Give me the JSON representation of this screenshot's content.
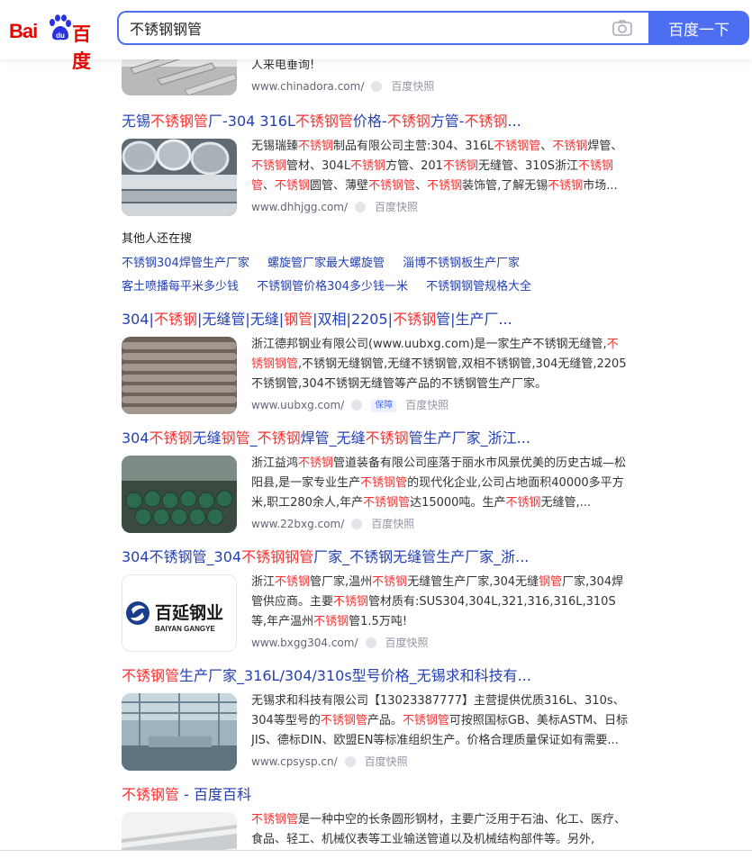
{
  "header": {
    "logo_latin": "Bai",
    "logo_cn": "百度",
    "search_value": "不锈钢钢管",
    "search_button": "百度一下"
  },
  "results": [
    {
      "title": [],
      "abstract": [
        {
          "t": "人来电垂询!"
        }
      ],
      "url": "www.chinadora.com/",
      "kuaizhao": "百度快照"
    },
    {
      "title": [
        {
          "t": "无锡"
        },
        {
          "t": "不锈钢管",
          "h": 1
        },
        {
          "t": "厂-304 316L"
        },
        {
          "t": "不锈钢管",
          "h": 1
        },
        {
          "t": "价格-"
        },
        {
          "t": "不锈钢",
          "h": 1
        },
        {
          "t": "方管-"
        },
        {
          "t": "不锈钢",
          "h": 1
        },
        {
          "t": "..."
        }
      ],
      "abstract": [
        {
          "t": "无锡瑞臻"
        },
        {
          "t": "不锈钢",
          "h": 1
        },
        {
          "t": "制品有限公司主营:304、316L"
        },
        {
          "t": "不锈钢管",
          "h": 1
        },
        {
          "t": "、"
        },
        {
          "t": "不锈钢",
          "h": 1
        },
        {
          "t": "焊管、"
        },
        {
          "t": "不锈钢",
          "h": 1
        },
        {
          "t": "管材、304L"
        },
        {
          "t": "不锈钢",
          "h": 1
        },
        {
          "t": "方管、201"
        },
        {
          "t": "不锈钢",
          "h": 1
        },
        {
          "t": "无缝管、310S浙江"
        },
        {
          "t": "不锈钢管",
          "h": 1
        },
        {
          "t": "、"
        },
        {
          "t": "不锈钢",
          "h": 1
        },
        {
          "t": "圆管、薄壁"
        },
        {
          "t": "不锈钢管",
          "h": 1
        },
        {
          "t": "、"
        },
        {
          "t": "不锈钢",
          "h": 1
        },
        {
          "t": "装饰管,了解无锡"
        },
        {
          "t": "不锈钢",
          "h": 1
        },
        {
          "t": "市场..."
        }
      ],
      "url": "www.dhhjgg.com/",
      "kuaizhao": "百度快照"
    },
    {
      "title": [
        {
          "t": "304|"
        },
        {
          "t": "不锈钢",
          "h": 1
        },
        {
          "t": "|无缝管|无缝|"
        },
        {
          "t": "钢管",
          "h": 1
        },
        {
          "t": "|双相|2205|"
        },
        {
          "t": "不锈钢",
          "h": 1
        },
        {
          "t": "管|生产厂..."
        }
      ],
      "abstract": [
        {
          "t": "浙江德邦钢业有限公司(www.uubxg.com)是一家生产不锈钢无缝管,"
        },
        {
          "t": "不锈钢钢管",
          "h": 1
        },
        {
          "t": ",不锈钢无缝钢管,无缝不锈钢管,双相不锈钢管,304无缝管,2205不锈钢管,304不锈钢无缝管等产品的不锈钢管生产厂家。"
        }
      ],
      "url": "www.uubxg.com/",
      "badge": "保障",
      "kuaizhao": "百度快照"
    },
    {
      "title": [
        {
          "t": "304"
        },
        {
          "t": "不锈钢",
          "h": 1
        },
        {
          "t": "无缝"
        },
        {
          "t": "钢管",
          "h": 1
        },
        {
          "t": "_"
        },
        {
          "t": "不锈钢",
          "h": 1
        },
        {
          "t": "焊管_无缝"
        },
        {
          "t": "不锈钢",
          "h": 1
        },
        {
          "t": "管生产厂家_浙江..."
        }
      ],
      "abstract": [
        {
          "t": "浙江益鸿"
        },
        {
          "t": "不锈钢",
          "h": 1
        },
        {
          "t": "管道装备有限公司座落于丽水市风景优美的历史古城—松阳县,是一家专业生产"
        },
        {
          "t": "不锈钢管",
          "h": 1
        },
        {
          "t": "的现代化企业,公司占地面积40000多平方米,职工280余人,年产"
        },
        {
          "t": "不锈钢管",
          "h": 1
        },
        {
          "t": "达15000吨。生产"
        },
        {
          "t": "不锈钢",
          "h": 1
        },
        {
          "t": "无缝管,..."
        }
      ],
      "url": "www.22bxg.com/",
      "kuaizhao": "百度快照"
    },
    {
      "title": [
        {
          "t": "304不锈钢管_304"
        },
        {
          "t": "不锈钢钢管",
          "h": 1
        },
        {
          "t": "厂家_不锈钢无缝管生产厂家_浙..."
        }
      ],
      "abstract": [
        {
          "t": "浙江"
        },
        {
          "t": "不锈钢",
          "h": 1
        },
        {
          "t": "管厂家,温州"
        },
        {
          "t": "不锈钢",
          "h": 1
        },
        {
          "t": "无缝管生产厂家,304无缝"
        },
        {
          "t": "钢管",
          "h": 1
        },
        {
          "t": "厂家,304焊管供应商。主要"
        },
        {
          "t": "不锈钢",
          "h": 1
        },
        {
          "t": "管材质有:SUS304,304L,321,316,316L,310S等,年产温州"
        },
        {
          "t": "不锈钢",
          "h": 1
        },
        {
          "t": "管1.5万吨!"
        }
      ],
      "url": "www.bxgg304.com/",
      "kuaizhao": "百度快照",
      "logo_cn": "百延钢业",
      "logo_en": "BAIYAN GANGYE"
    },
    {
      "title": [
        {
          "t": "不锈钢管",
          "h": 1
        },
        {
          "t": "生产厂家_316L/304/310s型号价格_无锡求和科技有..."
        }
      ],
      "abstract": [
        {
          "t": "无锡求和科技有限公司【13023387777】主营提供优质316L、310s、304等型号的"
        },
        {
          "t": "不锈钢管",
          "h": 1
        },
        {
          "t": "产品。"
        },
        {
          "t": "不锈钢管",
          "h": 1
        },
        {
          "t": "可按照国标GB、美标ASTM、日标JIS、德标DIN、欧盟EN等标准组织生产。价格合理质量保证如有需要..."
        }
      ],
      "url": "www.cpsysp.cn/",
      "kuaizhao": "百度快照"
    },
    {
      "title": [
        {
          "t": "不锈钢管",
          "h": 1
        },
        {
          "t": " - 百度百科"
        }
      ],
      "abstract": [
        {
          "t": "不锈钢管",
          "h": 1
        },
        {
          "t": "是一种中空的长条圆形钢材，主要广泛用于石油、化工、医疗、食品、轻工、机械仪表等工业输送管道以及机械结构部件等。另外,"
        }
      ],
      "url": "",
      "kuaizhao": ""
    }
  ],
  "others": {
    "title": "其他人还在搜",
    "row1": [
      "不锈钢304焊管生产厂家",
      "螺旋管厂家最大螺旋管",
      "淄博不锈钢板生产厂家"
    ],
    "row2": [
      "客土喷播每平米多少钱",
      "不锈钢管价格304多少钱一米",
      "不锈钢钢管规格大全"
    ]
  }
}
